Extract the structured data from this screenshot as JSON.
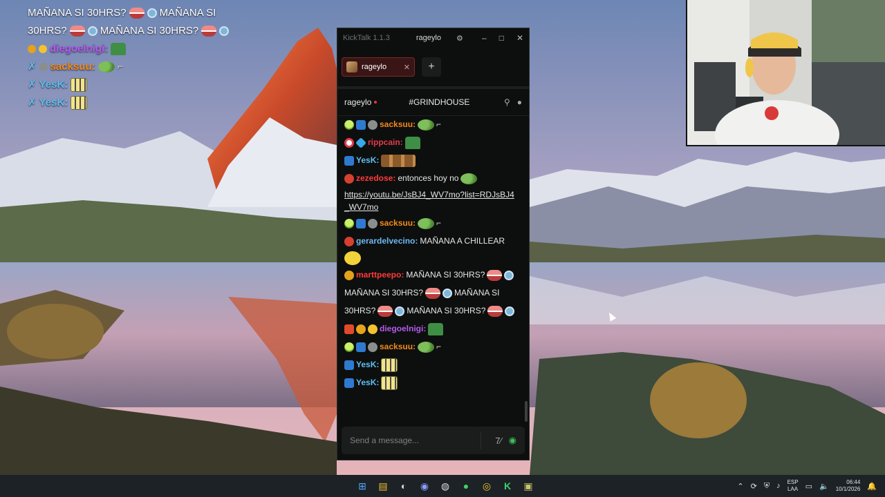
{
  "overlay_chat": {
    "line1_text_a": "MAÑANA SI 30HRS?",
    "line1_text_b": "MAÑANA SI",
    "line2_text_a": "30HRS?",
    "line2_text_b": "MAÑANA SI 30HRS?",
    "user_diego": "diegoelnigi:",
    "user_sacksuu": "sacksuu:",
    "user_yesk_1": "YesK:",
    "user_yesk_2": "YesK:"
  },
  "window": {
    "app_title": "KickTalk 1.1.3",
    "channel": "rageylo",
    "minimize": "–",
    "maximize": "□",
    "close": "✕"
  },
  "tabs": [
    {
      "label": "rageylo",
      "close": "✕"
    }
  ],
  "add_tab": "+",
  "header": {
    "streamer": "rageylo",
    "stream_title": "#GRINDHOUSE"
  },
  "messages": [
    {
      "user": "sacksuu:",
      "color": "#f28a1c"
    },
    {
      "user": "rippcain:",
      "color": "#e33b4b"
    },
    {
      "user": "YesK:",
      "color": "#5fbff2"
    },
    {
      "user": "zezedose:",
      "color": "#ff3a3a",
      "text": "entonces hoy no",
      "link": "https://youtu.be/JsBJ4_WV7mo?list=RDJsBJ4_WV7mo"
    },
    {
      "user": "sacksuu:",
      "color": "#f28a1c"
    },
    {
      "user": "gerardelvecino:",
      "color": "#6fb9f2",
      "text": "MAÑANA A CHILLEAR"
    },
    {
      "user": "marttpeepo:",
      "color": "#ff3a3a",
      "text1": "MAÑANA SI 30HRS?",
      "text2": "MAÑANA SI 30HRS?",
      "text3": "MAÑANA SI",
      "text4": "30HRS?",
      "text5": "MAÑANA SI 30HRS?"
    },
    {
      "user": "diegoelnigi:",
      "color": "#b45af0"
    },
    {
      "user": "sacksuu:",
      "color": "#f28a1c"
    },
    {
      "user": "YesK:",
      "color": "#5fbff2"
    },
    {
      "user": "YesK:",
      "color": "#5fbff2"
    }
  ],
  "input": {
    "placeholder": "Send a message..."
  },
  "tray": {
    "lang1": "ESP",
    "lang2": "LAA",
    "time": "06:44",
    "date": "10/1/2026"
  }
}
